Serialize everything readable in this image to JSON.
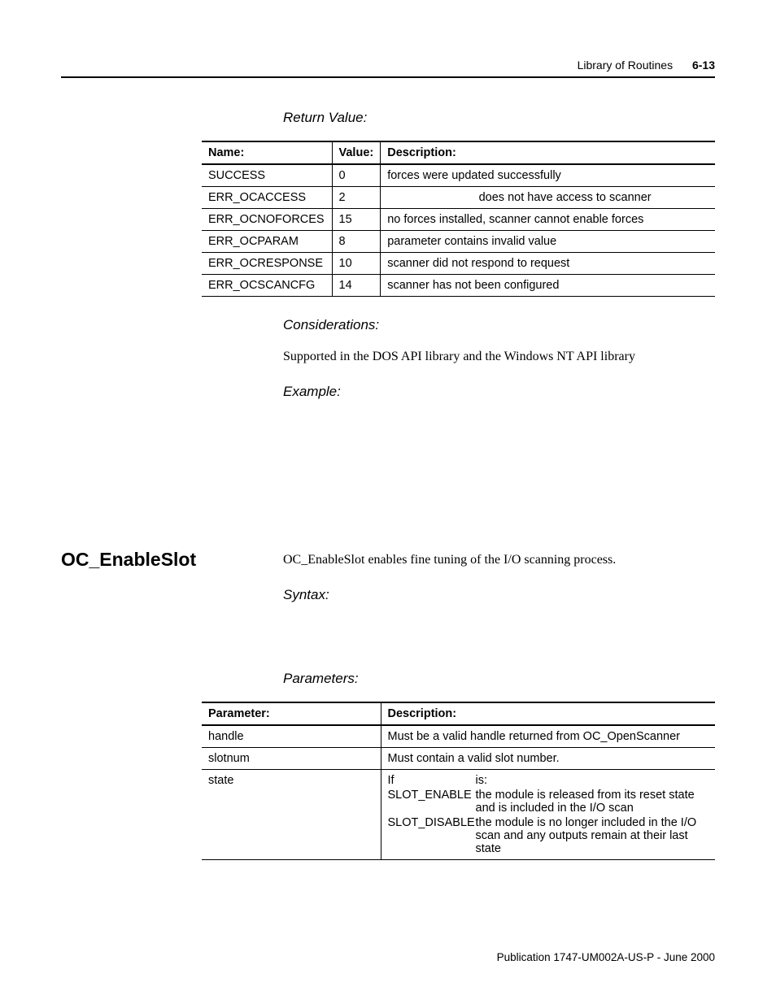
{
  "header": {
    "section": "Library of Routines",
    "pagenum": "6-13"
  },
  "returnValue": {
    "heading": "Return Value:",
    "columns": [
      "Name:",
      "Value:",
      "Description:"
    ],
    "rows": [
      {
        "name": "SUCCESS",
        "value": "0",
        "desc": "forces were updated successfully"
      },
      {
        "name": "ERR_OCACCESS",
        "value": "2",
        "desc": "does not have access to scanner",
        "centered": true
      },
      {
        "name": "ERR_OCNOFORCES",
        "value": "15",
        "desc": "no forces installed, scanner cannot enable forces"
      },
      {
        "name": "ERR_OCPARAM",
        "value": "8",
        "desc": "parameter contains invalid value"
      },
      {
        "name": "ERR_OCRESPONSE",
        "value": "10",
        "desc": "scanner did not respond to request"
      },
      {
        "name": "ERR_OCSCANCFG",
        "value": "14",
        "desc": "scanner has not been configured"
      }
    ]
  },
  "considerations": {
    "heading": "Considerations:",
    "text": "Supported in the DOS API library and the Windows NT API library"
  },
  "example": {
    "heading": "Example:"
  },
  "section2": {
    "title": "OC_EnableSlot",
    "intro": "OC_EnableSlot enables fine tuning of the I/O scanning process.",
    "syntax": "Syntax:",
    "parameters": "Parameters:",
    "paramColumns": [
      "Parameter:",
      "Description:"
    ],
    "paramRows": {
      "handle": {
        "name": "handle",
        "desc": "Must be a valid handle returned from OC_OpenScanner"
      },
      "slotnum": {
        "name": "slotnum",
        "desc": "Must contain a valid slot number."
      },
      "state": {
        "name": "state",
        "if": "If",
        "is": "is:",
        "enable_label": "SLOT_ENABLE",
        "enable_desc": "the module is released from its reset state and is included in the I/O scan",
        "disable_label": "SLOT_DISABLE",
        "disable_desc": "the module is no longer included in the I/O scan and any outputs remain at their last state"
      }
    }
  },
  "footer": "Publication 1747-UM002A-US-P - June 2000"
}
